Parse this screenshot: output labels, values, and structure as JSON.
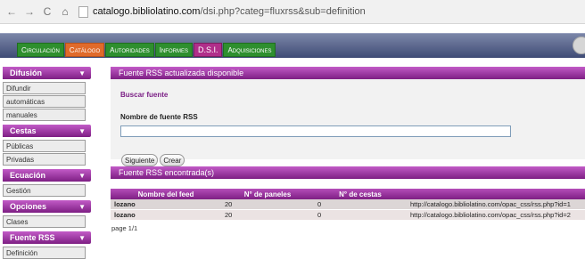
{
  "browser": {
    "nav": {
      "back": "←",
      "forward": "→",
      "reload": "C",
      "home": "⌂"
    },
    "url_host": "catalogo.bibliolatino.com",
    "url_path": "/dsi.php?categ=fluxrss&sub=definition"
  },
  "topmenu": {
    "items": [
      {
        "label": "Circulación"
      },
      {
        "label": "Catálogo"
      },
      {
        "label": "Autoridades"
      },
      {
        "label": "Informes"
      },
      {
        "label": "D.S.I."
      },
      {
        "label": "Adquisiciones"
      }
    ]
  },
  "sidebar": {
    "sections": [
      {
        "title": "Difusión",
        "items": [
          "Difundir",
          "automáticas",
          "manuales"
        ]
      },
      {
        "title": "Cestas",
        "items": [
          "Públicas",
          "Privadas"
        ]
      },
      {
        "title": "Ecuación",
        "items": [
          "Gestión"
        ]
      },
      {
        "title": "Opciones",
        "items": [
          "Clases"
        ]
      },
      {
        "title": "Fuente RSS",
        "items": [
          "Definición"
        ]
      }
    ],
    "chevron": "▼"
  },
  "main": {
    "panel_title": "Fuente RSS actualizada disponible",
    "find_title": "Buscar fuente",
    "field_label": "Nombre de fuente RSS",
    "search_value": "",
    "btn_next": "Siguiente",
    "btn_create": "Crear",
    "results_title": "Fuente RSS encontrada(s)",
    "table": {
      "headers": [
        "Nombre del feed",
        "N° de paneles",
        "N° de cestas",
        ""
      ],
      "rows": [
        [
          "lozano",
          "20",
          "0",
          "http://catalogo.bibliolatino.com/opac_css/rss.php?id=1"
        ],
        [
          "lozano",
          "20",
          "0",
          "http://catalogo.bibliolatino.com/opac_css/rss.php?id=2"
        ]
      ]
    },
    "page_info": "page 1/1"
  }
}
